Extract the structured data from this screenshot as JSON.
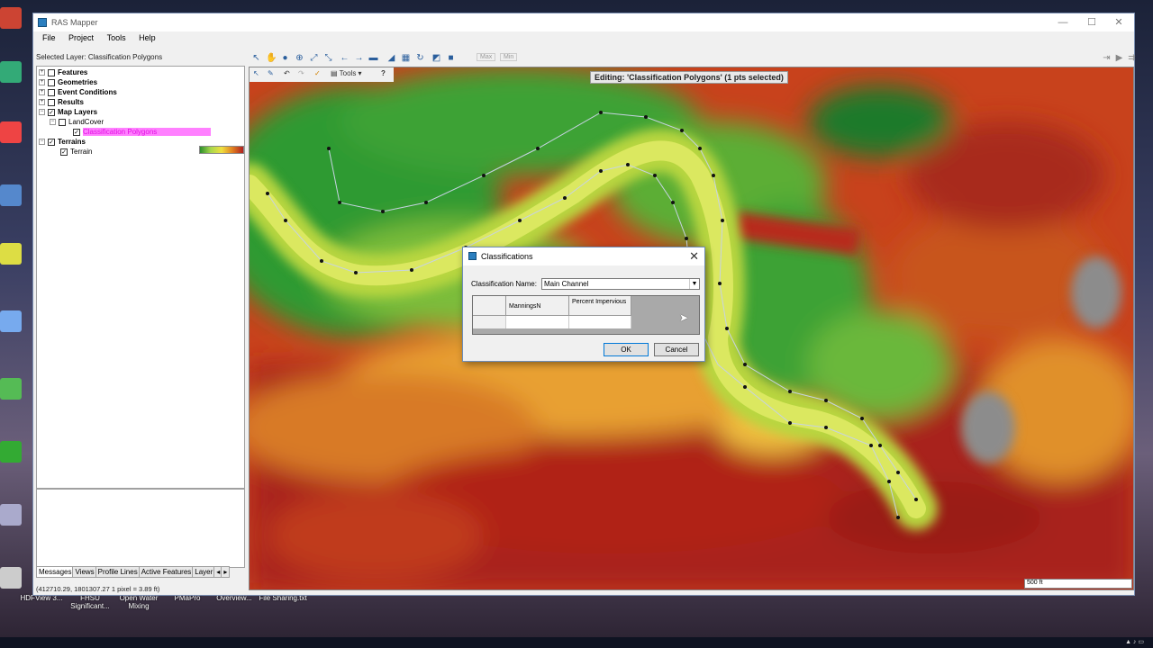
{
  "window": {
    "title": "RAS Mapper"
  },
  "menu": [
    "File",
    "Project",
    "Tools",
    "Help"
  ],
  "selected_layer": "Selected Layer: Classification Polygons",
  "tree": [
    {
      "label": "Features",
      "checked": false,
      "level": 0,
      "expander": "+"
    },
    {
      "label": "Geometries",
      "checked": false,
      "level": 0,
      "expander": "+"
    },
    {
      "label": "Event Conditions",
      "checked": false,
      "level": 0,
      "expander": "+"
    },
    {
      "label": "Results",
      "checked": false,
      "level": 0,
      "expander": "+"
    },
    {
      "label": "Map Layers",
      "checked": true,
      "level": 0,
      "expander": "-"
    },
    {
      "label": "LandCover",
      "checked": false,
      "level": 1,
      "expander": "-"
    },
    {
      "label": "Classification Polygons",
      "checked": true,
      "level": 2,
      "expander": ""
    },
    {
      "label": "Terrains",
      "checked": true,
      "level": 0,
      "expander": "-"
    },
    {
      "label": "Terrain",
      "checked": true,
      "level": 1,
      "expander": ""
    }
  ],
  "panel_tabs": [
    "Messages",
    "Views",
    "Profile Lines",
    "Active Features",
    "Layer "
  ],
  "statusbar": "(412710.29, 1801307.27  1 pixel = 3.89 ft)",
  "toolbar": {
    "max_label": "Max",
    "min_label": "Min",
    "tools_label": "Tools",
    "help_label": "?"
  },
  "map": {
    "editing_label": "Editing: 'Classification Polygons' (1 pts selected)",
    "scale_label": "500 ft"
  },
  "dialog": {
    "title": "Classifications",
    "name_label": "Classification Name:",
    "name_value": "Main Channel",
    "columns": [
      "ManningsN",
      "Percent Impervious"
    ],
    "ok_label": "OK",
    "cancel_label": "Cancel"
  },
  "desktop_labels": [
    "HDFView 3...",
    "FHSU Significant...",
    "Open Water Mixing",
    "PMaPro",
    "Overview...",
    "File Sharing.txt"
  ]
}
